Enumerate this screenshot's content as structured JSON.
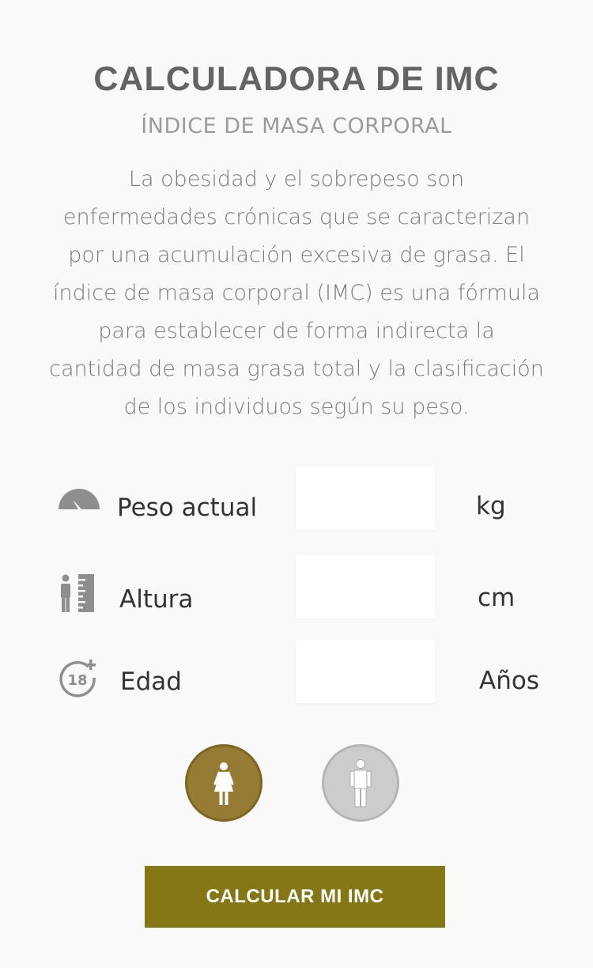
{
  "header": {
    "title": "CALCULADORA DE IMC",
    "subtitle": "ÍNDICE DE MASA CORPORAL"
  },
  "description": {
    "lines": [
      "La obesidad y el sobrepeso son",
      "enfermedades crónicas que se caracterizan",
      "por una acumulación excesiva de grasa. El",
      "índice de masa corporal (IMC) es una fórmula",
      "para establecer de forma indirecta la",
      "cantidad de masa grasa total y la clasificación",
      "de los individuos según  su peso."
    ]
  },
  "form": {
    "weight": {
      "label": "Peso actual",
      "value": "",
      "unit": "kg",
      "icon": "gauge-icon"
    },
    "height": {
      "label": "Altura",
      "value": "",
      "unit": "cm",
      "icon": "height-ruler-icon"
    },
    "age": {
      "label": "Edad",
      "value": "",
      "unit": "Años",
      "icon": "age-18-plus-icon"
    }
  },
  "gender": {
    "selected": "female",
    "female_icon": "female-person-icon",
    "male_icon": "male-person-icon"
  },
  "actions": {
    "calculate_label": "CALCULAR MI IMC"
  },
  "colors": {
    "accent": "#857713",
    "female_selected": "#957b33",
    "male_unselected": "#cccccc",
    "title": "#646464",
    "subtitle": "#9b9b9b",
    "icon_gray": "#8e8e8e"
  }
}
